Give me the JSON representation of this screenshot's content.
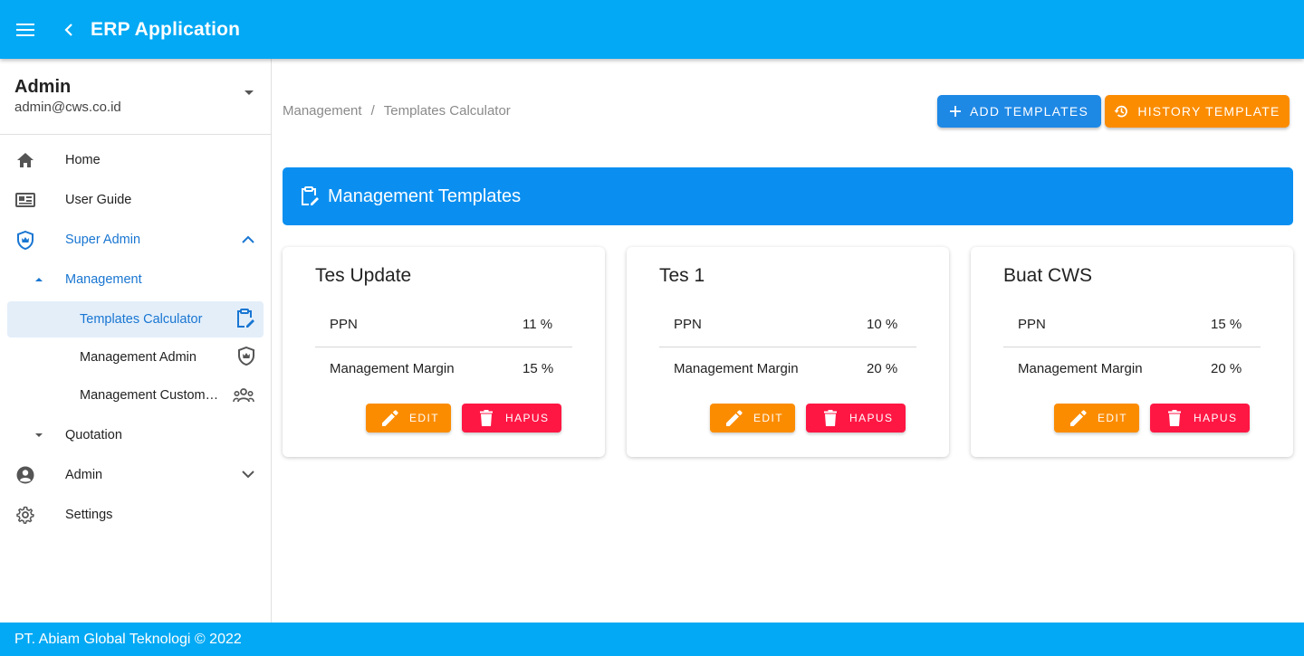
{
  "app": {
    "title": "ERP Application"
  },
  "user": {
    "name": "Admin",
    "email": "admin@cws.co.id"
  },
  "nav": {
    "home": "Home",
    "user_guide": "User Guide",
    "super_admin": "Super Admin",
    "management": "Management",
    "templates_calculator": "Templates Calculator",
    "management_admin": "Management Admin",
    "management_customer": "Management Custom…",
    "quotation": "Quotation",
    "admin": "Admin",
    "settings": "Settings"
  },
  "breadcrumb": {
    "parent": "Management",
    "separator": "/",
    "current": "Templates Calculator"
  },
  "actions": {
    "add_templates": "ADD TEMPLATES",
    "history_template": "HISTORY TEMPLATE"
  },
  "banner": {
    "title": "Management Templates"
  },
  "templates": [
    {
      "title": "Tes Update",
      "ppn_label": "PPN",
      "ppn_value": "11 %",
      "margin_label": "Management Margin",
      "margin_value": "15 %",
      "edit": "EDIT",
      "delete": "HAPUS"
    },
    {
      "title": "Tes 1",
      "ppn_label": "PPN",
      "ppn_value": "10 %",
      "margin_label": "Management Margin",
      "margin_value": "20 %",
      "edit": "EDIT",
      "delete": "HAPUS"
    },
    {
      "title": "Buat CWS",
      "ppn_label": "PPN",
      "ppn_value": "15 %",
      "margin_label": "Management Margin",
      "margin_value": "20 %",
      "edit": "EDIT",
      "delete": "HAPUS"
    }
  ],
  "footer": {
    "text": "PT. Abiam Global Teknologi © 2022"
  },
  "colors": {
    "appbar": "#03a9f4",
    "primary_button": "#1e88e5",
    "orange": "#fb8c00",
    "red": "#ff1744",
    "banner": "#0a8ff0",
    "active_nav": "#1976d2"
  }
}
